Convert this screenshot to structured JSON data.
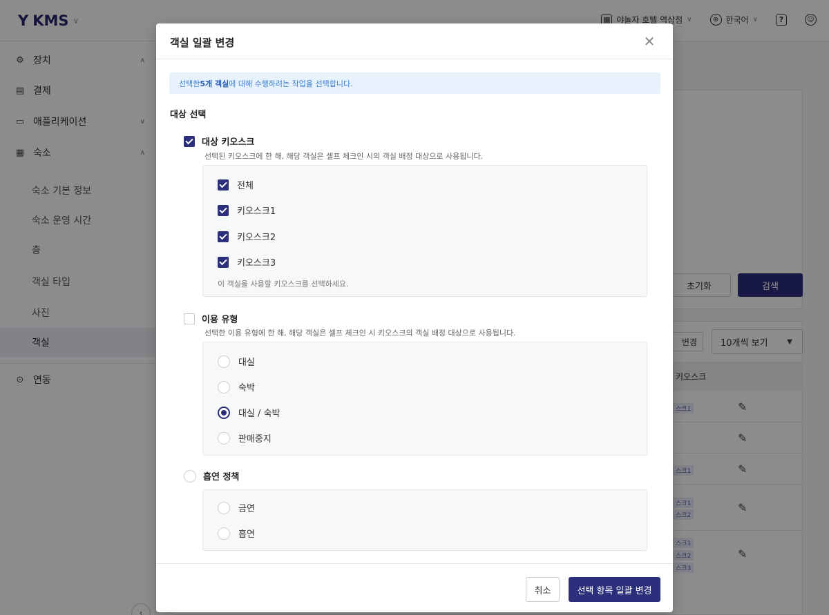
{
  "topbar": {
    "logo": "KMS",
    "property": "야놀자 호텔 역삼점",
    "language": "한국어",
    "help_icon": "?"
  },
  "sidebar": {
    "items": [
      {
        "label": "장치",
        "icon": "gear-icon"
      },
      {
        "label": "결제",
        "icon": "receipt-icon"
      },
      {
        "label": "애플리케이션",
        "icon": "tablet-icon"
      },
      {
        "label": "숙소",
        "icon": "building-icon"
      }
    ],
    "sub_items": [
      "숙소 기본 정보",
      "숙소 운영 시간",
      "층",
      "객실 타입",
      "사진",
      "객실"
    ],
    "active_sub": "객실",
    "link_item": {
      "label": "연동",
      "icon": "link-icon"
    }
  },
  "main": {
    "reset_label": "초기화",
    "search_label": "검색",
    "bulk_label": "변경",
    "page_size": "10개씩 보기",
    "table_header": "키오스크",
    "row_tags": [
      [
        "스크1"
      ],
      [],
      [
        "스크1"
      ],
      [
        "스크1",
        "스크2"
      ],
      [
        "스크1",
        "스크2",
        "스크3"
      ]
    ]
  },
  "modal": {
    "title": "객실 일괄 변경",
    "info_prefix": "선택한 ",
    "info_count": "5개 객실",
    "info_suffix": "에 대해 수행하려는 작업을 선택합니다.",
    "section_title": "대상 선택",
    "kiosk": {
      "label": "대상 키오스크",
      "checked": true,
      "desc": "선택된 키오스크에 한 해, 해당 객실은 셀프 체크인 시의 객실 배정 대상으로 사용됩니다.",
      "options": [
        {
          "label": "전체",
          "checked": true
        },
        {
          "label": "키오스크1",
          "checked": true
        },
        {
          "label": "키오스크2",
          "checked": true
        },
        {
          "label": "키오스크3",
          "checked": true
        }
      ],
      "hint": "이 객실을 사용할 키오스크를 선택하세요."
    },
    "usage": {
      "label": "이용 유형",
      "checked": false,
      "desc": "선택한 이용 유형에 한 해, 해당 객실은 셀프 체크인 시 키오스크의 객실 배정 대상으로 사용됩니다.",
      "options": [
        "대실",
        "숙박",
        "대실 / 숙박",
        "판매중지"
      ],
      "selected": "대실 / 숙박"
    },
    "smoking": {
      "label": "흡연 정책",
      "checked": false,
      "options": [
        "금연",
        "흡연"
      ],
      "selected": ""
    },
    "cancel_label": "취소",
    "apply_label": "선택 항목 일괄 변경"
  },
  "colors": {
    "primary": "#2b2f7c",
    "info_bg": "#e8f2fd",
    "info_text": "#3c7fd4"
  }
}
